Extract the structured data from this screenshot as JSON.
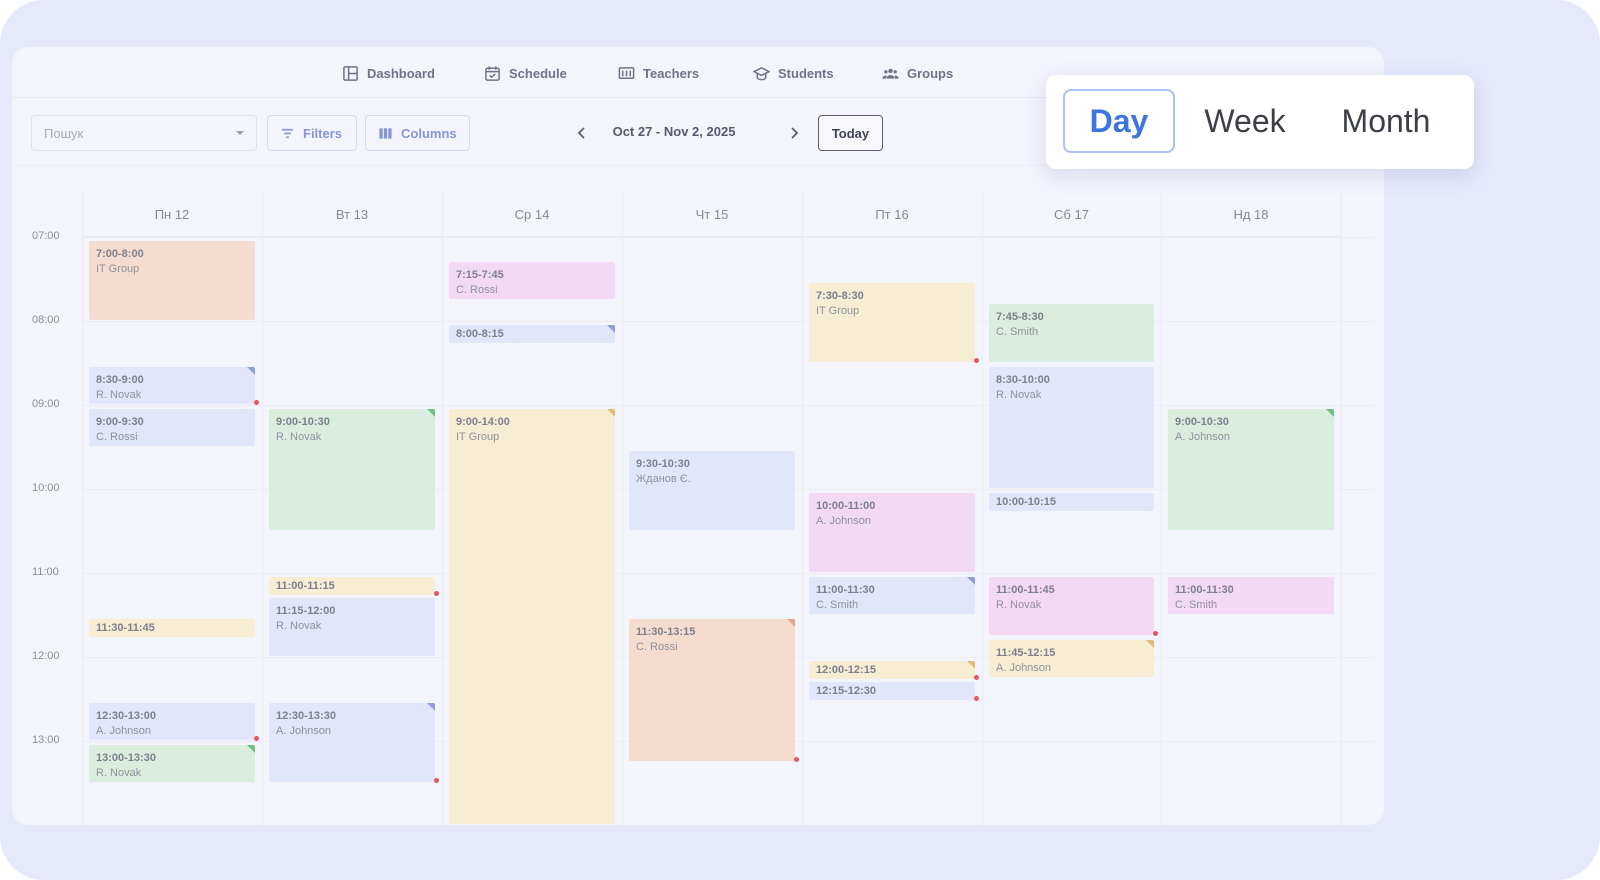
{
  "nav": [
    {
      "label": "Dashboard",
      "icon": "dashboard-icon"
    },
    {
      "label": "Schedule",
      "icon": "calendar-icon"
    },
    {
      "label": "Teachers",
      "icon": "teachers-icon"
    },
    {
      "label": "Students",
      "icon": "graduation-cap-icon"
    },
    {
      "label": "Groups",
      "icon": "groups-icon"
    }
  ],
  "toolbar": {
    "search_placeholder": "Пошук",
    "filters_label": "Filters",
    "columns_label": "Columns",
    "date_range": "Oct 27 - Nov 2, 2025",
    "today_label": "Today"
  },
  "view_switcher": {
    "options": [
      "Day",
      "Week",
      "Month"
    ],
    "selected": "Day",
    "accent_color": "#3d74df"
  },
  "calendar": {
    "days": [
      "Пн 12",
      "Вт 13",
      "Ср 14",
      "Чт 15",
      "Пт 16",
      "Сб 17",
      "Нд 18"
    ],
    "times": [
      "07:00",
      "08:00",
      "09:00",
      "10:00",
      "11:00",
      "12:00",
      "13:00"
    ],
    "events": [
      {
        "day": 0,
        "time": "7:00-8:00",
        "name": "IT Group",
        "color": "orange",
        "corner": false,
        "dot": false
      },
      {
        "day": 0,
        "time": "8:30-9:00",
        "name": "R. Novak",
        "color": "blue",
        "corner": true,
        "dot": true
      },
      {
        "day": 0,
        "time": "9:00-9:30",
        "name": "C. Rossi",
        "color": "blue",
        "corner": false,
        "dot": false
      },
      {
        "day": 0,
        "time": "11:30-11:45",
        "name": "",
        "color": "yellow",
        "corner": false,
        "dot": false
      },
      {
        "day": 0,
        "time": "12:30-13:00",
        "name": "A. Johnson",
        "color": "blue",
        "corner": false,
        "dot": true
      },
      {
        "day": 0,
        "time": "13:00-13:30",
        "name": "R. Novak",
        "color": "green",
        "corner": true,
        "dot": false
      },
      {
        "day": 1,
        "time": "9:00-10:30",
        "name": "R. Novak",
        "color": "green",
        "corner": true,
        "dot": false
      },
      {
        "day": 1,
        "time": "11:00-11:15",
        "name": "",
        "color": "yellow",
        "corner": false,
        "dot": true
      },
      {
        "day": 1,
        "time": "11:15-12:00",
        "name": "R. Novak",
        "color": "blue",
        "corner": false,
        "dot": false
      },
      {
        "day": 1,
        "time": "12:30-13:30",
        "name": "A. Johnson",
        "color": "blue",
        "corner": true,
        "dot": true
      },
      {
        "day": 2,
        "time": "7:15-7:45",
        "name": "C. Rossi",
        "color": "pink",
        "corner": false,
        "dot": false
      },
      {
        "day": 2,
        "time": "8:00-8:15",
        "name": "",
        "color": "blue",
        "corner": true,
        "dot": false
      },
      {
        "day": 2,
        "time": "9:00-14:00",
        "name": "IT Group",
        "color": "yellow",
        "corner": true,
        "dot": false
      },
      {
        "day": 3,
        "time": "9:30-10:30",
        "name": "Жданов Є.",
        "color": "blue",
        "corner": false,
        "dot": false
      },
      {
        "day": 3,
        "time": "11:30-13:15",
        "name": "C. Rossi",
        "color": "orange",
        "corner": true,
        "dot": true
      },
      {
        "day": 4,
        "time": "7:30-8:30",
        "name": "IT Group",
        "color": "yellow",
        "corner": false,
        "dot": true
      },
      {
        "day": 4,
        "time": "10:00-11:00",
        "name": "A. Johnson",
        "color": "pink",
        "corner": false,
        "dot": false
      },
      {
        "day": 4,
        "time": "11:00-11:30",
        "name": "C. Smith",
        "color": "blue",
        "corner": true,
        "dot": false
      },
      {
        "day": 4,
        "time": "12:00-12:15",
        "name": "",
        "color": "yellow",
        "corner": true,
        "dot": true
      },
      {
        "day": 4,
        "time": "12:15-12:30",
        "name": "",
        "color": "blue",
        "corner": false,
        "dot": true
      },
      {
        "day": 5,
        "time": "7:45-8:30",
        "name": "C. Smith",
        "color": "green",
        "corner": false,
        "dot": false
      },
      {
        "day": 5,
        "time": "8:30-10:00",
        "name": "R. Novak",
        "color": "blue",
        "corner": false,
        "dot": false
      },
      {
        "day": 5,
        "time": "10:00-10:15",
        "name": "",
        "color": "blue",
        "corner": false,
        "dot": false
      },
      {
        "day": 5,
        "time": "11:00-11:45",
        "name": "R. Novak",
        "color": "pink",
        "corner": false,
        "dot": true
      },
      {
        "day": 5,
        "time": "11:45-12:15",
        "name": "A. Johnson",
        "color": "yellow",
        "corner": true,
        "dot": false
      },
      {
        "day": 6,
        "time": "9:00-10:30",
        "name": "A. Johnson",
        "color": "green",
        "corner": true,
        "dot": false
      },
      {
        "day": 6,
        "time": "11:00-11:30",
        "name": "C. Smith",
        "color": "pink",
        "corner": false,
        "dot": false
      }
    ]
  }
}
